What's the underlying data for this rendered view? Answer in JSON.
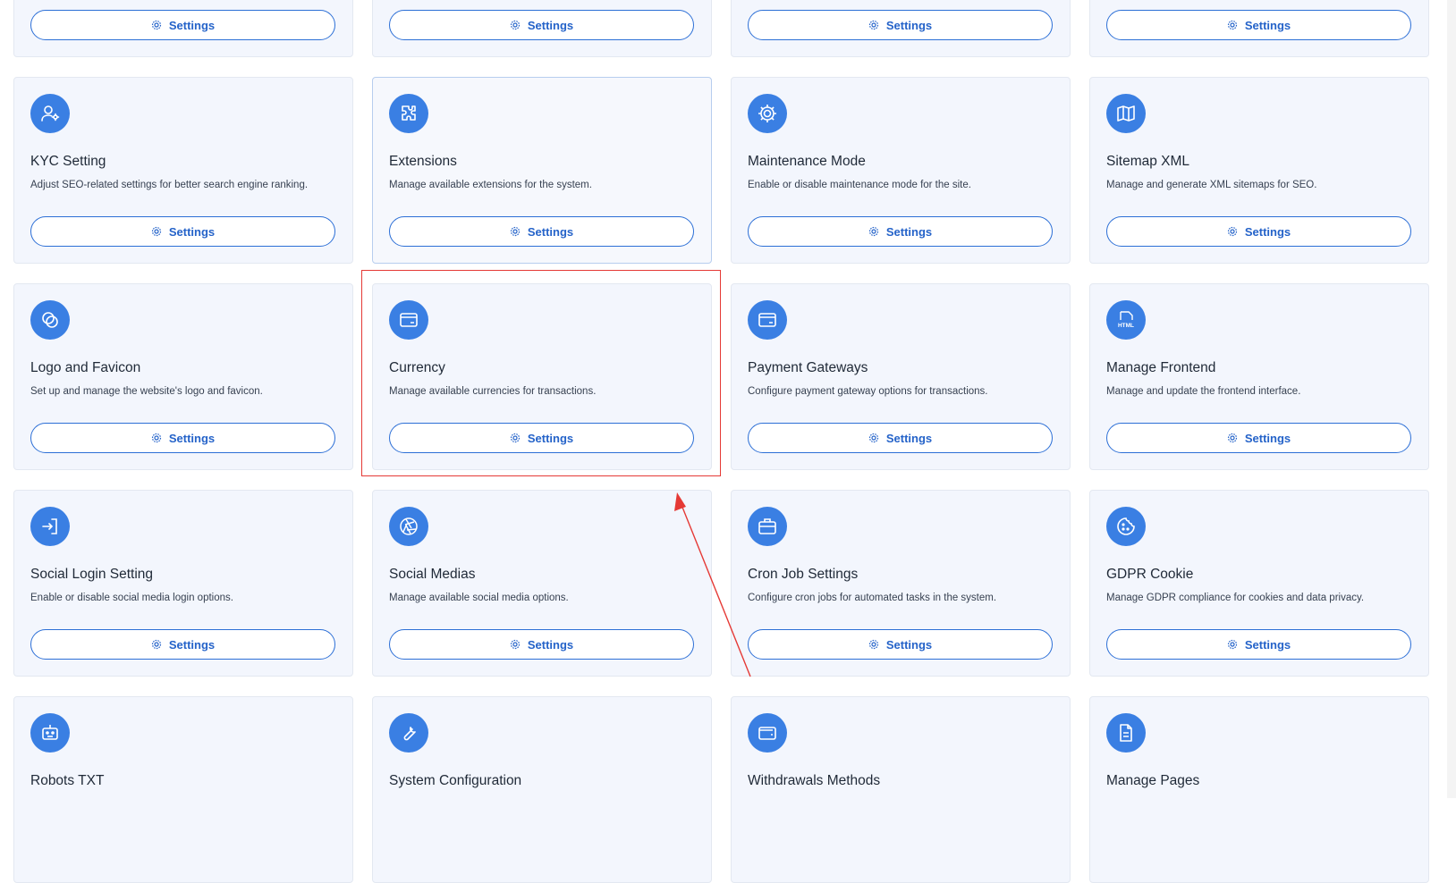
{
  "cards": [
    {
      "id": "row0-c1",
      "title": "",
      "desc": "",
      "button": "Settings",
      "icon": "none"
    },
    {
      "id": "row0-c2",
      "title": "",
      "desc": "",
      "button": "Settings",
      "icon": "none"
    },
    {
      "id": "row0-c3",
      "title": "",
      "desc": "",
      "button": "Settings",
      "icon": "none"
    },
    {
      "id": "row0-c4",
      "title": "",
      "desc": "",
      "button": "Settings",
      "icon": "none"
    },
    {
      "id": "kyc",
      "title": "KYC Setting",
      "desc": "Adjust SEO-related settings for better search engine ranking.",
      "button": "Settings",
      "icon": "user-gear-icon"
    },
    {
      "id": "extensions",
      "title": "Extensions",
      "desc": "Manage available extensions for the system.",
      "button": "Settings",
      "icon": "puzzle-icon"
    },
    {
      "id": "maintenance",
      "title": "Maintenance Mode",
      "desc": "Enable or disable maintenance mode for the site.",
      "button": "Settings",
      "icon": "gear-icon"
    },
    {
      "id": "sitemap",
      "title": "Sitemap XML",
      "desc": "Manage and generate XML sitemaps for SEO.",
      "button": "Settings",
      "icon": "map-icon"
    },
    {
      "id": "logo",
      "title": "Logo and Favicon",
      "desc": "Set up and manage the website's logo and favicon.",
      "button": "Settings",
      "icon": "circles-icon"
    },
    {
      "id": "currency",
      "title": "Currency",
      "desc": "Manage available currencies for transactions.",
      "button": "Settings",
      "icon": "card-icon"
    },
    {
      "id": "payment",
      "title": "Payment Gateways",
      "desc": "Configure payment gateway options for transactions.",
      "button": "Settings",
      "icon": "card-icon"
    },
    {
      "id": "frontend",
      "title": "Manage Frontend",
      "desc": "Manage and update the frontend interface.",
      "button": "Settings",
      "icon": "html-file-icon"
    },
    {
      "id": "sociallogin",
      "title": "Social Login Setting",
      "desc": "Enable or disable social media login options.",
      "button": "Settings",
      "icon": "login-icon"
    },
    {
      "id": "socialmedias",
      "title": "Social Medias",
      "desc": "Manage available social media options.",
      "button": "Settings",
      "icon": "aperture-icon"
    },
    {
      "id": "cron",
      "title": "Cron Job Settings",
      "desc": "Configure cron jobs for automated tasks in the system.",
      "button": "Settings",
      "icon": "briefcase-icon"
    },
    {
      "id": "gdpr",
      "title": "GDPR Cookie",
      "desc": "Manage GDPR compliance for cookies and data privacy.",
      "button": "Settings",
      "icon": "cookie-icon"
    },
    {
      "id": "robots",
      "title": "Robots TXT",
      "desc": "",
      "button": "",
      "icon": "robot-icon"
    },
    {
      "id": "sysconfig",
      "title": "System Configuration",
      "desc": "",
      "button": "",
      "icon": "wrench-icon"
    },
    {
      "id": "withdraw",
      "title": "Withdrawals Methods",
      "desc": "",
      "button": "",
      "icon": "wallet-icon"
    },
    {
      "id": "pages",
      "title": "Manage Pages",
      "desc": "",
      "button": "",
      "icon": "document-icon"
    }
  ],
  "colors": {
    "accent": "#3a7fe3",
    "annotation": "#e53935",
    "card_bg": "#f3f6fd"
  }
}
